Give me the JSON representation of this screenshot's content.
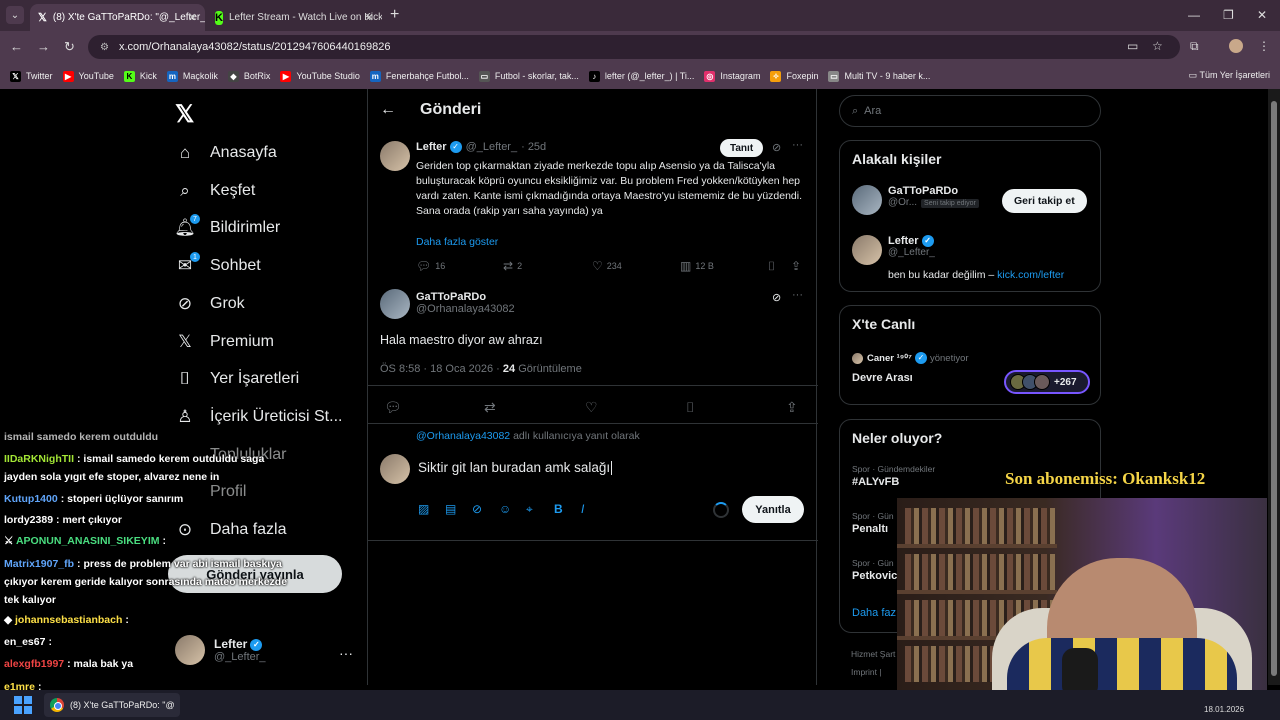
{
  "browser": {
    "tabs": [
      {
        "title": "(8) X'te GaTToPaRDo: \"@_Lefter_",
        "icon": "x-icon",
        "active": true
      },
      {
        "title": "Lefter Stream - Watch Live on Kick",
        "icon": "kick-icon",
        "active": false
      }
    ],
    "url": "x.com/Orhanalaya43082/status/2012947606440169826",
    "bookmarks": [
      {
        "label": "Twitter",
        "icon": "x-icon",
        "color": "#000000"
      },
      {
        "label": "YouTube",
        "icon": "youtube-icon",
        "color": "#ff0000"
      },
      {
        "label": "Kick",
        "icon": "kick-icon",
        "color": "#53fc18"
      },
      {
        "label": "Maçkolik",
        "icon": "mackolik-icon",
        "color": "#1565c0"
      },
      {
        "label": "BotRix",
        "icon": "botrix-icon",
        "color": "#444444"
      },
      {
        "label": "YouTube Studio",
        "icon": "youtube-studio-icon",
        "color": "#ff0000"
      },
      {
        "label": "Fenerbahçe Futbol...",
        "icon": "fenerbahce-icon",
        "color": "#1565c0"
      },
      {
        "label": "Futbol - skorlar, tak...",
        "icon": "flashscore-icon",
        "color": "#555555"
      },
      {
        "label": "lefter (@_lefter_) | Ti...",
        "icon": "tiktok-icon",
        "color": "#000000"
      },
      {
        "label": "Instagram",
        "icon": "instagram-icon",
        "color": "#e1306c"
      },
      {
        "label": "Foxepin",
        "icon": "foxepin-icon",
        "color": "#f59e0b"
      },
      {
        "label": "Multi TV - 9 haber k...",
        "icon": "multitv-icon",
        "color": "#888888"
      }
    ],
    "all_bookmarks": "Tüm Yer İşaretleri"
  },
  "nav": {
    "items": [
      {
        "label": "Anasayfa",
        "icon": "home-icon"
      },
      {
        "label": "Keşfet",
        "icon": "search-icon"
      },
      {
        "label": "Bildirimler",
        "icon": "bell-icon",
        "badge": "7"
      },
      {
        "label": "Sohbet",
        "icon": "mail-icon",
        "badge": "1"
      },
      {
        "label": "Grok",
        "icon": "grok-icon"
      },
      {
        "label": "Premium",
        "icon": "x-premium-icon"
      },
      {
        "label": "Yer İşaretleri",
        "icon": "bookmark-icon"
      },
      {
        "label": "İçerik Üreticisi St...",
        "icon": "creator-studio-icon"
      },
      {
        "label": "Topluluklar",
        "icon": "communities-icon"
      },
      {
        "label": "Profil",
        "icon": "profile-icon"
      },
      {
        "label": "Daha fazla",
        "icon": "more-circle-icon"
      }
    ],
    "post_button": "Gönderi yayınla",
    "account": {
      "name": "Lefter",
      "handle": "@_Lefter_"
    }
  },
  "main": {
    "title": "Gönderi",
    "tweet1": {
      "name": "Lefter",
      "handle": "@_Lefter_",
      "time": "· 25d",
      "follow_label": "Tanıt",
      "text": "Geriden top çıkarmaktan ziyade merkezde topu alıp Asensio ya da Talisca'yla buluşturacak köprü oyuncu eksikliğimiz var. Bu problem Fred yokken/kötüyken hep vardı zaten. Kante ismi çıkmadığında ortaya Maestro'yu istememiz de bu yüzdendi. Sana orada (rakip yarı saha yayında) ya",
      "show_more": "Daha fazla göster",
      "replies": "16",
      "reposts": "2",
      "likes": "234",
      "views": "12 B"
    },
    "tweet2": {
      "name": "GaTToPaRDo",
      "handle": "@Orhanalaya43082",
      "text": "Hala maestro diyor aw ahrazı",
      "timestamp": "ÖS 8:58 · 18 Oca 2026 ·",
      "views": "24",
      "views_label": "Görüntüleme"
    },
    "reply": {
      "replying_to_handle": "@Orhanalaya43082",
      "replying_to_suffix": "adlı kullanıcıya yanıt olarak",
      "draft": "Siktir git lan buradan amk salağı",
      "button": "Yanıtla"
    }
  },
  "sidebar": {
    "search_placeholder": "Ara",
    "relevant": {
      "title": "Alakalı kişiler",
      "people": [
        {
          "name": "GaTToPaRDo",
          "handle": "@Or...",
          "tag": "Seni takip ediyor",
          "button": "Geri takip et"
        },
        {
          "name": "Lefter",
          "handle": "@_Lefter_",
          "bio": "ben bu kadar değilim –",
          "bio_link": "kick.com/lefter"
        }
      ]
    },
    "live": {
      "title": "X'te Canlı",
      "host": "Caner ¹⁹⁰⁷",
      "host_role": "yönetiyor",
      "space_title": "Devre Arası",
      "listeners": "+267"
    },
    "trends": {
      "title": "Neler oluyor?",
      "items": [
        {
          "meta": "Spor · Gündemdekiler",
          "name": "#ALYvFB"
        },
        {
          "meta": "Spor · Gün",
          "name": "Penaltı"
        },
        {
          "meta": "Spor · Gün",
          "name": "Petkovic"
        }
      ],
      "more": "Daha faz"
    },
    "footer": [
      "Hizmet Şart",
      "Imprint |"
    ]
  },
  "stream": {
    "sub_banner": "Son abonemiss: Okanksk12",
    "chat": [
      {
        "user": "",
        "text": "ismail samedo kerem outduldu",
        "color": "#ffffff"
      },
      {
        "user": "IIDaRKNighTII",
        "text": ": ismail samedo kerem outduldu saga jayden sola yıgıt efe stoper, alvarez nene in",
        "color": "#a3e635"
      },
      {
        "user": "Kutup1400",
        "text": ": stoperi üçlüyor sanırım",
        "color": "#60a5fa"
      },
      {
        "user": "lordy2389",
        "text": ": mert çıkıyor",
        "color": "#ffffff"
      },
      {
        "user": "APONUN_ANASINI_SIKEYIM",
        "text": ":",
        "color": "#4ade80"
      },
      {
        "user": "Matrix1907_fb",
        "text": ": press de problem var abi ismail baskıya çıkıyor kerem geride kalıyor sonrasında mateo merkezde tek kalıyor",
        "color": "#60a5fa"
      },
      {
        "user": "johannsebastianbach",
        "text": ":",
        "color": "#fde047"
      },
      {
        "user": "en_es67",
        "text": ":",
        "color": "#ffffff"
      },
      {
        "user": "alexgfb1997",
        "text": ": mala bak ya",
        "color": "#ef4444"
      },
      {
        "user": "e1mre",
        "text": ":",
        "color": "#fde047"
      }
    ]
  },
  "taskbar": {
    "app_title": "(8) X'te GaTToPaRDo: \"@",
    "date": "18.01.2026"
  }
}
